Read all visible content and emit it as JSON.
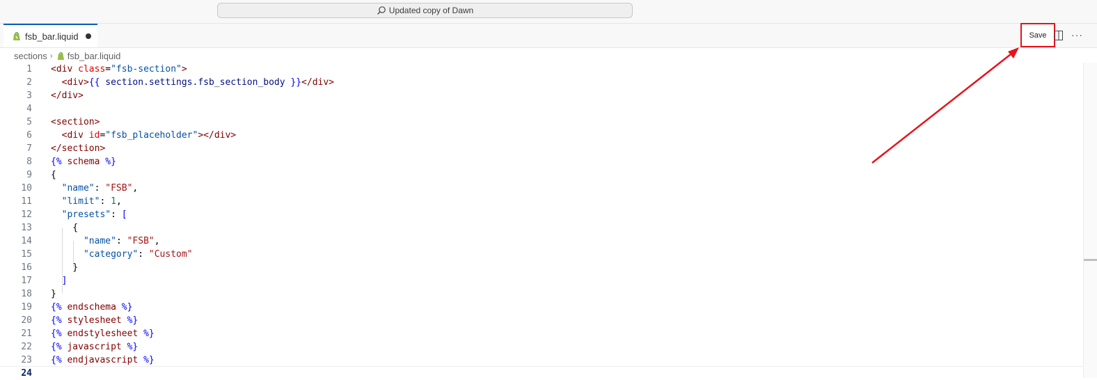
{
  "title_bar": {
    "command_center_label": "Updated copy of Dawn"
  },
  "tabs": [
    {
      "label": "fsb_bar.liquid",
      "modified": true
    }
  ],
  "toolbar": {
    "save_label": "Save",
    "more_label": "···"
  },
  "breadcrumb": {
    "folder": "sections",
    "file": "fsb_bar.liquid"
  },
  "editor": {
    "active_line": "24",
    "lines": [
      {
        "n": "1"
      },
      {
        "n": "2"
      },
      {
        "n": "3"
      },
      {
        "n": "4"
      },
      {
        "n": "5"
      },
      {
        "n": "6"
      },
      {
        "n": "7"
      },
      {
        "n": "8"
      },
      {
        "n": "9"
      },
      {
        "n": "10"
      },
      {
        "n": "11"
      },
      {
        "n": "12"
      },
      {
        "n": "13"
      },
      {
        "n": "14"
      },
      {
        "n": "15"
      },
      {
        "n": "16"
      },
      {
        "n": "17"
      },
      {
        "n": "18"
      },
      {
        "n": "19"
      },
      {
        "n": "20"
      },
      {
        "n": "21"
      },
      {
        "n": "22"
      },
      {
        "n": "23"
      },
      {
        "n": "24"
      }
    ],
    "code": {
      "l1": [
        "<div ",
        "class",
        "=",
        "\"fsb-section\"",
        ">"
      ],
      "l2": [
        "  <div>",
        "{{",
        " section.settings.fsb_section_body ",
        "}}",
        "</div>"
      ],
      "l3": [
        "</div>"
      ],
      "l5": [
        "<section>"
      ],
      "l6": [
        "  <div ",
        "id",
        "=",
        "\"fsb_placeholder\"",
        "></div>"
      ],
      "l7": [
        "</section>"
      ],
      "l8": [
        "{%",
        " schema ",
        "%}"
      ],
      "l9": [
        "{"
      ],
      "l10": [
        "  ",
        "\"name\"",
        ": ",
        "\"FSB\"",
        ","
      ],
      "l11": [
        "  ",
        "\"limit\"",
        ": ",
        "1",
        ","
      ],
      "l12": [
        "  ",
        "\"presets\"",
        ": ",
        "["
      ],
      "l13": [
        "    {"
      ],
      "l14": [
        "      ",
        "\"name\"",
        ": ",
        "\"FSB\"",
        ","
      ],
      "l15": [
        "      ",
        "\"category\"",
        ": ",
        "\"Custom\""
      ],
      "l16": [
        "    }"
      ],
      "l17": [
        "  ",
        "]"
      ],
      "l18": [
        "}"
      ],
      "l19": [
        "{%",
        " endschema ",
        "%}"
      ],
      "l20": [
        "{%",
        " stylesheet ",
        "%}"
      ],
      "l21": [
        "{%",
        " endstylesheet ",
        "%}"
      ],
      "l22": [
        "{%",
        " javascript ",
        "%}"
      ],
      "l23": [
        "{%",
        " endjavascript ",
        "%}"
      ]
    }
  },
  "colors": {
    "accent": "#005fb8",
    "annotation": "#e8121a"
  },
  "icons": {
    "search": "search-icon",
    "file": "shopify-liquid-icon",
    "split": "split-editor-icon",
    "more": "more-actions-icon"
  }
}
